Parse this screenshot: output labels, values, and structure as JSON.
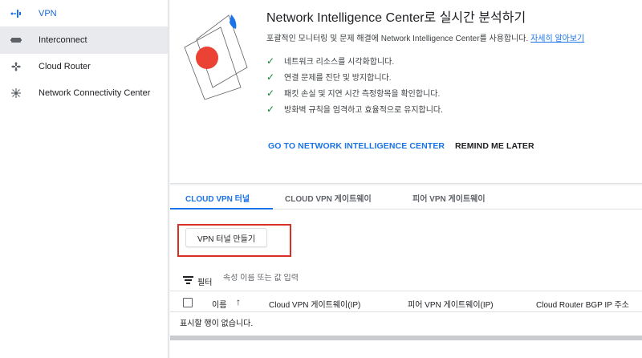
{
  "sidebar": {
    "items": [
      {
        "label": "VPN",
        "icon": "vpn-icon",
        "active": true
      },
      {
        "label": "Interconnect",
        "icon": "interconnect-icon"
      },
      {
        "label": "Cloud Router",
        "icon": "cloud-router-icon"
      },
      {
        "label": "Network Connectivity Center",
        "icon": "network-connectivity-icon"
      }
    ]
  },
  "promo": {
    "title": "Network Intelligence Center로 실시간 분석하기",
    "subtitle": "포괄적인 모니터링 및 문제 해결에 Network Intelligence Center를 사용합니다.",
    "learn_more": "자세히 알아보기",
    "checks": [
      "네트워크 리소스를 시각화합니다.",
      "연결 문제를 진단 및 방지합니다.",
      "패킷 손실 및 지연 시간 측정항목을 확인합니다.",
      "방화벽 규칙을 엄격하고 효율적으로 유지합니다."
    ],
    "primary_action": "GO TO NETWORK INTELLIGENCE CENTER",
    "dismiss_action": "REMIND ME LATER"
  },
  "tabs": [
    {
      "label": "CLOUD VPN 터널",
      "active": true
    },
    {
      "label": "CLOUD VPN 게이트웨이"
    },
    {
      "label": "피어 VPN 게이트웨이"
    }
  ],
  "create_button": "VPN 터널 만들기",
  "filter": {
    "label": "필터",
    "placeholder": "속성 이름 또는 값 입력"
  },
  "table": {
    "columns": [
      "이름",
      "Cloud VPN 게이트웨이(IP)",
      "피어 VPN 게이트웨이(IP)",
      "Cloud Router BGP IP 주소"
    ],
    "empty_text": "표시할 행이 없습니다."
  },
  "colors": {
    "accent": "#1a73e8",
    "highlight": "#d93025",
    "check": "#188038"
  }
}
